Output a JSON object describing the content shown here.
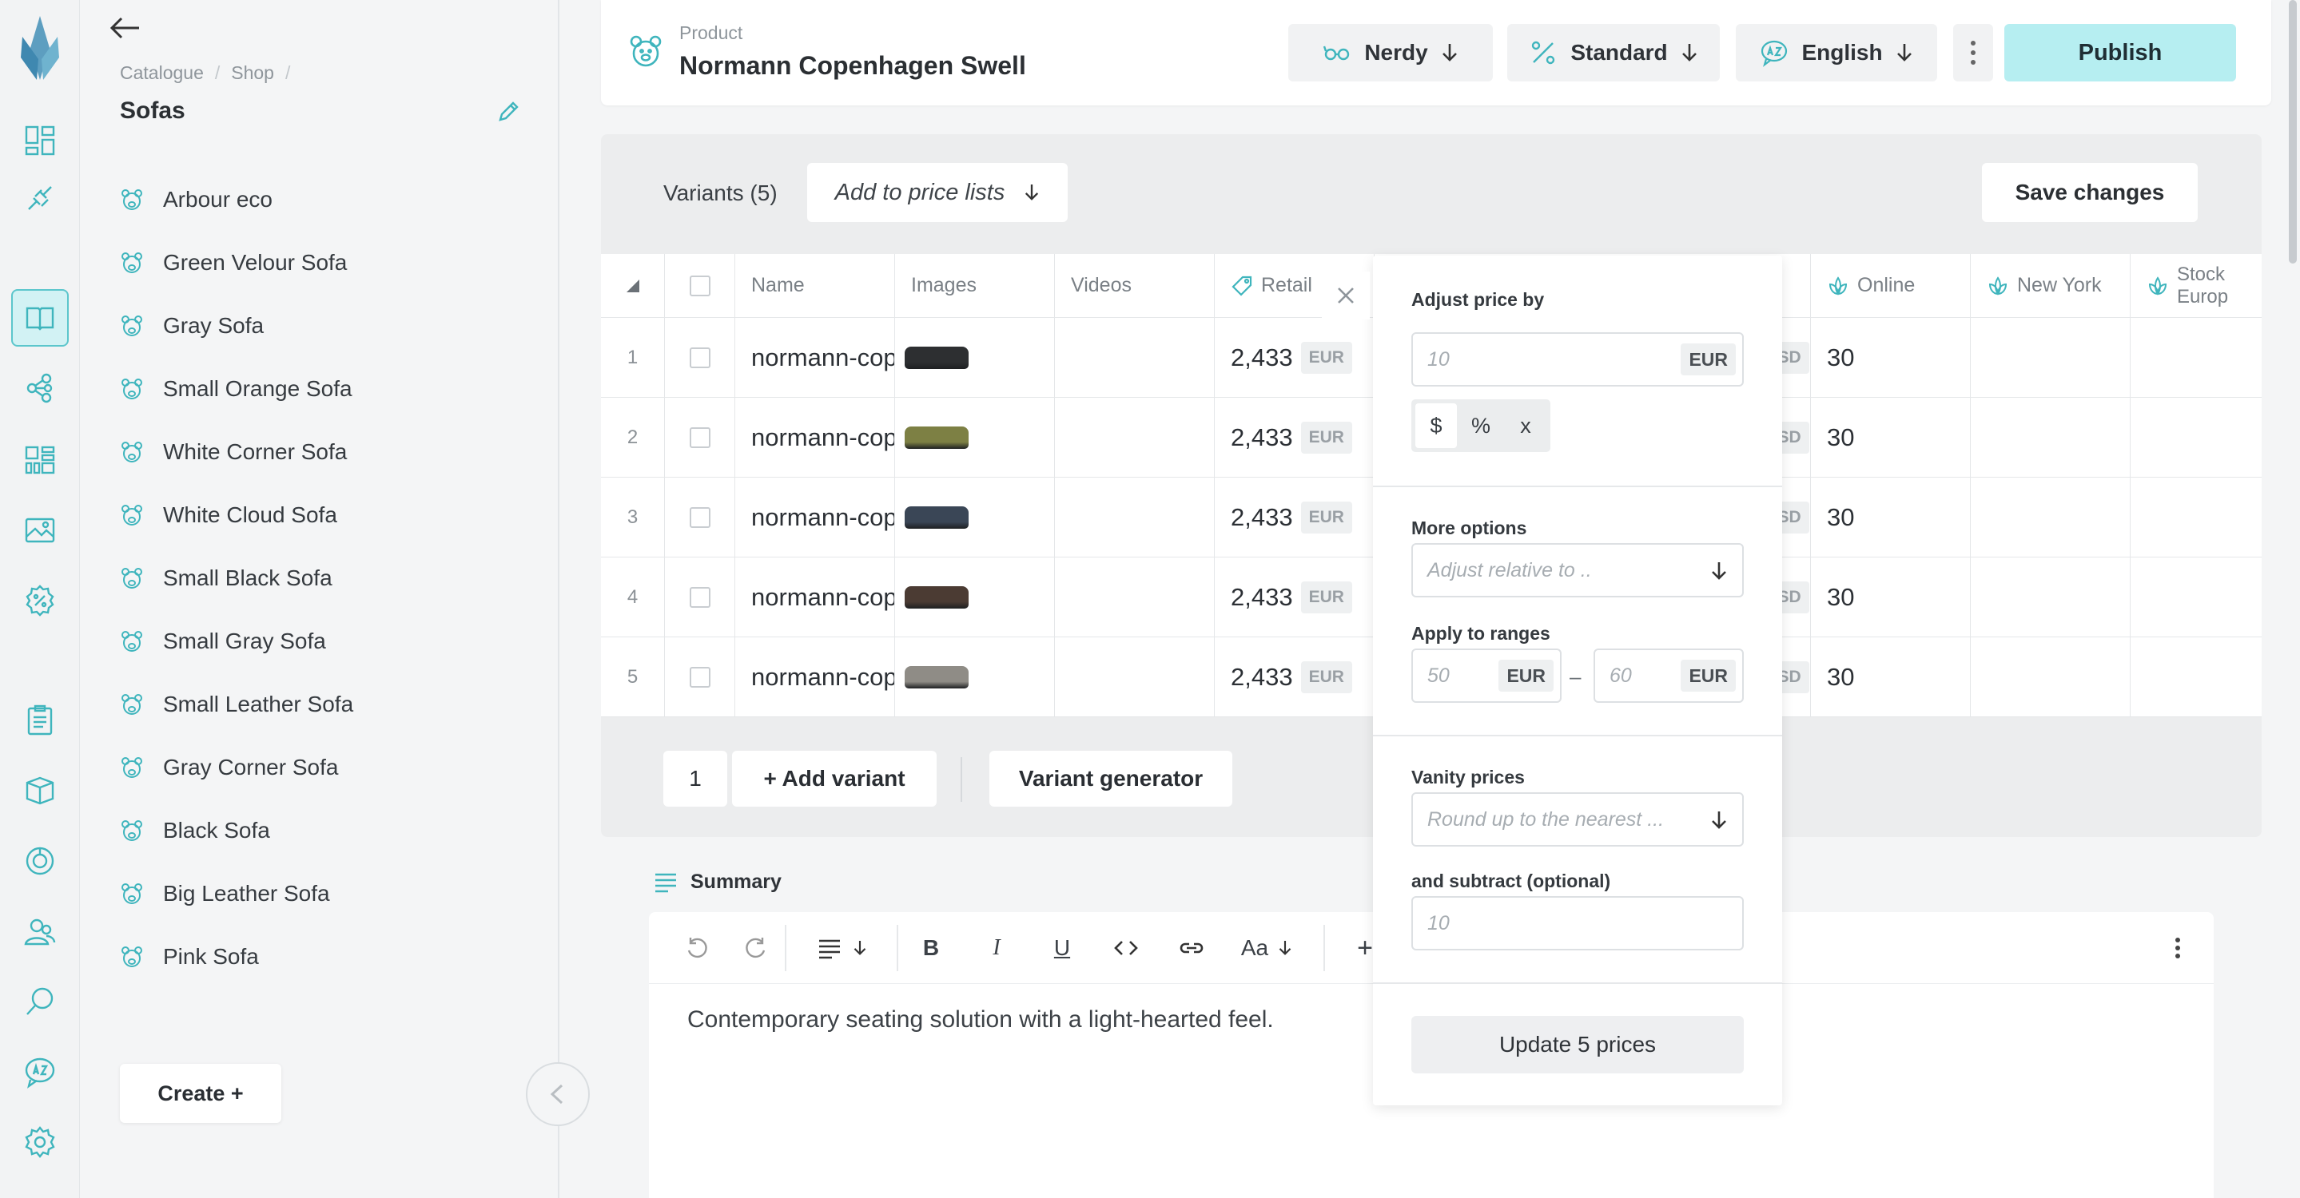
{
  "rail": {
    "icons": [
      "logo-icon",
      "dashboard-icon",
      "integrations-icon",
      "catalogue-icon",
      "shapes-icon",
      "grid-icon",
      "media-icon",
      "discount-icon",
      "orders-icon",
      "stock-icon",
      "reports-icon",
      "customers-icon",
      "search-icon",
      "translate-icon",
      "settings-icon"
    ],
    "active": "catalogue-icon"
  },
  "sidebar": {
    "breadcrumb": [
      "Catalogue",
      "Shop"
    ],
    "title": "Sofas",
    "items": [
      "Arbour eco",
      "Green Velour Sofa",
      "Gray Sofa",
      "Small Orange Sofa",
      "White Corner Sofa",
      "White Cloud Sofa",
      "Small Black Sofa",
      "Small Gray Sofa",
      "Small Leather Sofa",
      "Gray Corner Sofa",
      "Black Sofa",
      "Big Leather Sofa",
      "Pink Sofa"
    ],
    "create_label": "Create +"
  },
  "header": {
    "kind": "Product",
    "title": "Normann Copenhagen Swell",
    "tone_label": "Nerdy",
    "tier_label": "Standard",
    "language_label": "English",
    "publish_label": "Publish"
  },
  "variants": {
    "count_label": "Variants (5)",
    "add_to_price_lists": "Add to price lists",
    "save_label": "Save changes",
    "columns": {
      "name": "Name",
      "images": "Images",
      "videos": "Videos",
      "retail": "Retail",
      "online": "Online",
      "new_york": "New York",
      "stock_europe": "Stock Europ"
    },
    "rows": [
      {
        "num": "1",
        "name": "normann-copenhagen-swell",
        "retail": "2,433",
        "retail_cur": "EUR",
        "usd_cur": "USD",
        "online": "30",
        "thumb": "#2d2f31"
      },
      {
        "num": "2",
        "name": "normann-copenhagen-swell",
        "retail": "2,433",
        "retail_cur": "EUR",
        "usd_cur": "USD",
        "online": "30",
        "thumb": "#7d8044"
      },
      {
        "num": "3",
        "name": "normann-copenhagen-swell",
        "retail": "2,433",
        "retail_cur": "EUR",
        "usd_cur": "USD",
        "online": "30",
        "thumb": "#3a4656"
      },
      {
        "num": "4",
        "name": "normann-copenhagen-swell",
        "retail": "2,433",
        "retail_cur": "EUR",
        "usd_cur": "USD",
        "online": "30",
        "thumb": "#4b3b33"
      },
      {
        "num": "5",
        "name": "normann-copenhagen-swell",
        "retail": "2,433",
        "retail_cur": "EUR",
        "usd_cur": "USD",
        "online": "30",
        "thumb": "#8f8c86"
      }
    ],
    "footer_count": "1",
    "add_variant_label": "+ Add variant",
    "generator_label": "Variant generator"
  },
  "summary": {
    "label": "Summary",
    "font_label": "Aa",
    "plus_label": "+",
    "text": "Contemporary seating solution with a light-hearted feel."
  },
  "popover": {
    "adjust_label": "Adjust price by",
    "adjust_placeholder": "10",
    "adjust_currency": "EUR",
    "modes": [
      "$",
      "%",
      "x"
    ],
    "active_mode": "$",
    "more_options_label": "More options",
    "relative_placeholder": "Adjust relative to ..",
    "ranges_label": "Apply to ranges",
    "range_from": "50",
    "range_to": "60",
    "range_currency": "EUR",
    "range_dash": "–",
    "vanity_label": "Vanity prices",
    "vanity_placeholder": "Round up to the nearest ...",
    "subtract_label": "and subtract (optional)",
    "subtract_placeholder": "10",
    "update_label": "Update 5 prices"
  },
  "colors": {
    "accent": "#3fb5bd",
    "accent_light": "#b6eef1"
  }
}
